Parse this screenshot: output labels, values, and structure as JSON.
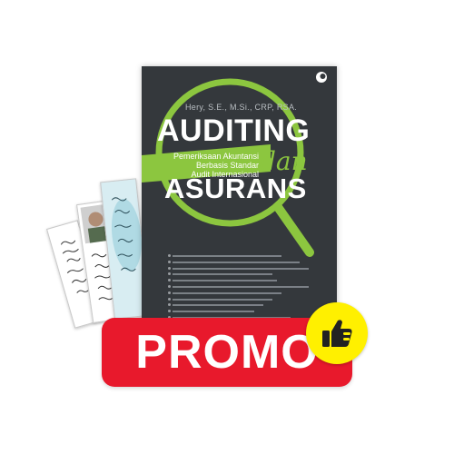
{
  "book": {
    "author": "Hery, S.E., M.Si., CRP, RSA.",
    "title_line1": "AUDITING",
    "subtitle_line1": "Pemeriksaan Akuntansi",
    "subtitle_line2": "Berbasis Standar",
    "subtitle_line3": "Audit Internasional",
    "conjunction": "dan",
    "title_line2": "ASURANS",
    "toc_line_count_hidden": ""
  },
  "banner": {
    "label": "PROMO"
  },
  "icons": {
    "publisher_logo": "publisher-logo-icon",
    "thumbs_up": "thumbs-up-icon"
  },
  "colors": {
    "book_cover": "#34383c",
    "accent_green": "#8cc63f",
    "promo_red": "#e8192c",
    "badge_yellow": "#fff000"
  }
}
